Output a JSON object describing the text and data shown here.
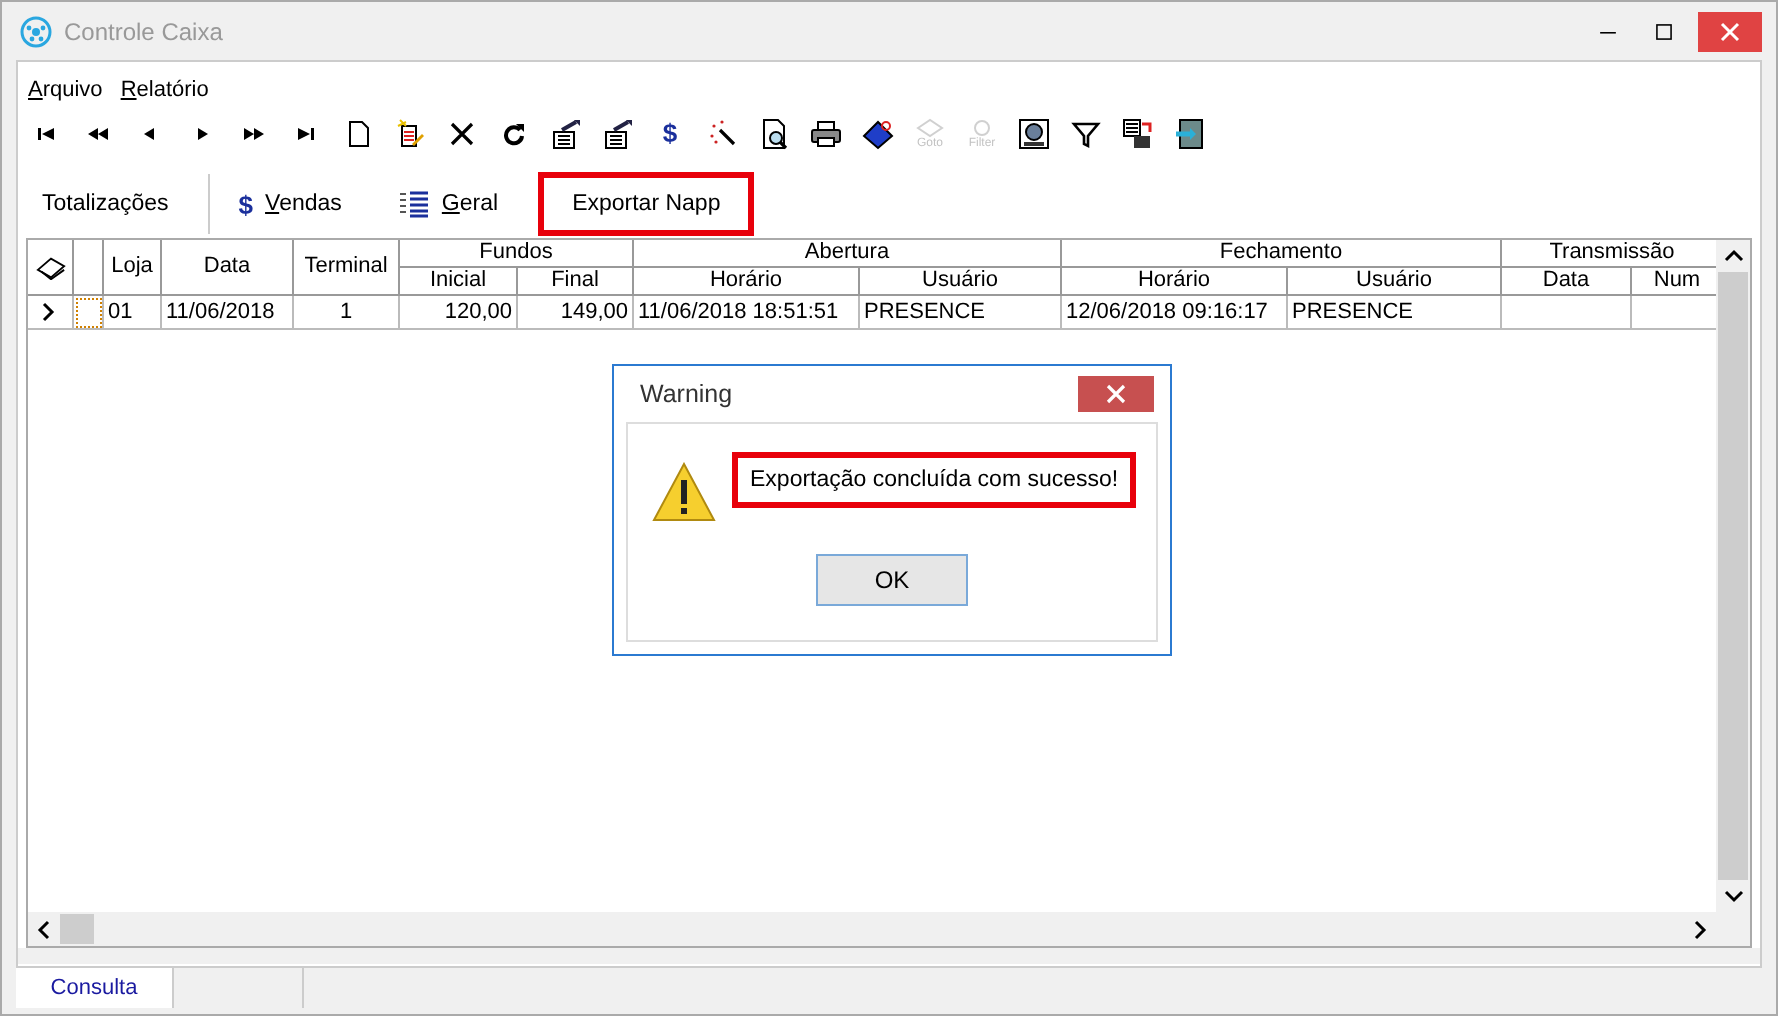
{
  "window": {
    "title": "Controle Caixa"
  },
  "menu": [
    {
      "label": "Arquivo"
    },
    {
      "label": "Relatório"
    }
  ],
  "toolbar": [
    {
      "kind": "first",
      "disabled": false
    },
    {
      "kind": "prev-page",
      "disabled": false
    },
    {
      "kind": "prev",
      "disabled": false
    },
    {
      "kind": "next",
      "disabled": false
    },
    {
      "kind": "next-page",
      "disabled": false
    },
    {
      "kind": "last",
      "disabled": false
    },
    {
      "kind": "new",
      "disabled": false
    },
    {
      "kind": "edit",
      "disabled": false
    },
    {
      "kind": "delete",
      "disabled": false
    },
    {
      "kind": "refresh",
      "disabled": false
    },
    {
      "kind": "export",
      "disabled": false
    },
    {
      "kind": "import",
      "disabled": false
    },
    {
      "kind": "symbol",
      "symbol": "$",
      "disabled": false
    },
    {
      "kind": "wand",
      "disabled": false
    },
    {
      "kind": "preview",
      "disabled": false
    },
    {
      "kind": "print",
      "disabled": false
    },
    {
      "kind": "tag",
      "disabled": false
    },
    {
      "kind": "goto",
      "label": "Goto",
      "disabled": true
    },
    {
      "kind": "filter-box",
      "label": "Filter",
      "disabled": true
    },
    {
      "kind": "monitor",
      "disabled": false
    },
    {
      "kind": "funnel",
      "disabled": false
    },
    {
      "kind": "save",
      "disabled": false
    },
    {
      "kind": "exit",
      "disabled": false
    }
  ],
  "tabs": [
    {
      "kind": "plain",
      "label": "Totalizações",
      "highlighted": false
    },
    {
      "kind": "symbol",
      "symbol": "$",
      "label": "Vendas",
      "highlighted": false
    },
    {
      "kind": "list",
      "label": "Geral",
      "highlighted": false
    },
    {
      "kind": "plain",
      "label": "Exportar Napp",
      "highlighted": true
    }
  ],
  "table": {
    "column_groups": [
      {
        "label": "Fundos"
      },
      {
        "label": "Abertura"
      },
      {
        "label": "Fechamento"
      },
      {
        "label": "Transmissão"
      }
    ],
    "columns": [
      {
        "kind": "single",
        "label": "Loja"
      },
      {
        "kind": "single",
        "label": "Data"
      },
      {
        "kind": "single",
        "label": "Terminal"
      },
      {
        "kind": "grouped",
        "label": "Inicial"
      },
      {
        "kind": "grouped",
        "label": "Final"
      },
      {
        "kind": "grouped",
        "label": "Horário"
      },
      {
        "kind": "grouped",
        "label": "Usuário"
      },
      {
        "kind": "grouped",
        "label": "Horário"
      },
      {
        "kind": "grouped",
        "label": "Usuário"
      },
      {
        "kind": "grouped",
        "label": "Data"
      },
      {
        "kind": "grouped",
        "label": "Num"
      }
    ],
    "rows": [
      {
        "current": true,
        "cells": [
          "01",
          "11/06/2018",
          "1",
          "120,00",
          "149,00",
          "11/06/2018 18:51:51",
          "PRESENCE",
          "12/06/2018 09:16:17",
          "PRESENCE",
          "",
          ""
        ]
      }
    ]
  },
  "dialog": {
    "title": "Warning",
    "message": "Exportação concluída com sucesso!",
    "message_highlighted": true,
    "button": "OK"
  },
  "status_bar": {
    "panels": [
      "Consulta"
    ]
  }
}
